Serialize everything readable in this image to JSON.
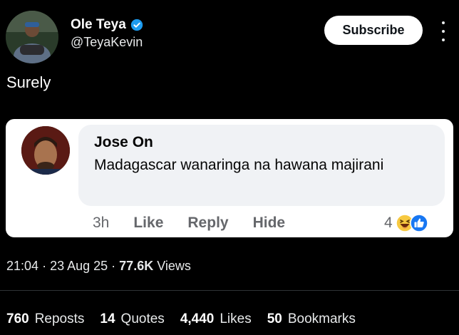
{
  "author": {
    "name": "Ole Teya",
    "handle": "@TeyaKevin"
  },
  "subscribe_label": "Subscribe",
  "post_text": "Surely",
  "quoted_comment": {
    "commenter": "Jose On",
    "text": "Madagascar wanaringa na hawana majirani",
    "time": "3h",
    "actions": [
      "Like",
      "Reply",
      "Hide"
    ],
    "reaction_count": "4",
    "reaction_icons": [
      "laugh-emoji-icon",
      "like-emoji-icon"
    ]
  },
  "meta": {
    "time": "21:04",
    "date": "23 Aug 25",
    "views": "77.6K",
    "views_label": "Views"
  },
  "stats": [
    {
      "count": "760",
      "label": "Reposts"
    },
    {
      "count": "14",
      "label": "Quotes"
    },
    {
      "count": "4,440",
      "label": "Likes"
    },
    {
      "count": "50",
      "label": "Bookmarks"
    }
  ],
  "colors": {
    "background": "#000000",
    "verified": "#1d9bf0",
    "card": "#ffffff",
    "bubble": "#f0f2f5",
    "fb_like": "#1877f2"
  }
}
